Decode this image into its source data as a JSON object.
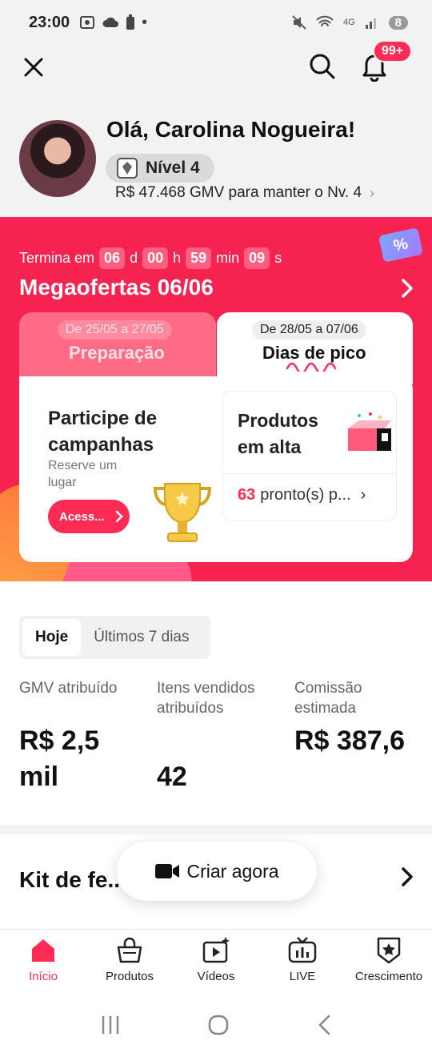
{
  "status_bar": {
    "time": "23:00",
    "network": "4G",
    "battery": "8"
  },
  "header": {
    "notification_badge": "99+",
    "greeting": "Olá, Carolina Nogueira!",
    "level_label": "Nível 4",
    "gmv_to_keep": "R$ 47.468 GMV para manter o Nv. 4"
  },
  "promo": {
    "countdown_prefix": "Termina em",
    "days": "06",
    "days_unit": "d",
    "hours": "00",
    "hours_unit": "h",
    "minutes": "59",
    "minutes_unit": "min",
    "seconds": "09",
    "seconds_unit": "s",
    "title": "Megaofertas 06/06",
    "coupon_symbol": "%",
    "tabs": [
      {
        "date": "De 25/05 a 27/05",
        "name": "Preparação",
        "active": false
      },
      {
        "date": "De 28/05 a 07/06",
        "name": "Dias de pico",
        "active": true
      }
    ],
    "campaign_title": "Participe de campanhas",
    "campaign_subtitle": "Reserve um lugar",
    "access_button": "Acess...",
    "trending_title": "Produtos em alta",
    "trending_count": "63",
    "trending_suffix": "pronto(s) p..."
  },
  "stats": {
    "periods": [
      "Hoje",
      "Últimos 7 dias"
    ],
    "selected_period": "Hoje",
    "metrics": [
      {
        "label": "GMV atribuído",
        "value": "R$ 2,5 mil"
      },
      {
        "label": "Itens vendidos atribuídos",
        "value": "42"
      },
      {
        "label": "Comissão estimada",
        "value": "R$ 387,6"
      }
    ]
  },
  "kit": {
    "title": "Kit de fe... Shop",
    "create_button": "Criar agora"
  },
  "bottom_nav": [
    {
      "label": "Início",
      "icon": "home-icon",
      "active": true
    },
    {
      "label": "Produtos",
      "icon": "bag-icon",
      "active": false
    },
    {
      "label": "Vídeos",
      "icon": "video-icon",
      "active": false
    },
    {
      "label": "LIVE",
      "icon": "live-tv-icon",
      "active": false
    },
    {
      "label": "Crescimento",
      "icon": "growth-badge-icon",
      "active": false
    }
  ],
  "colors": {
    "accent": "#fe2c55",
    "promo_bg": "#f6224f",
    "header_bg": "#f2f2f2"
  }
}
